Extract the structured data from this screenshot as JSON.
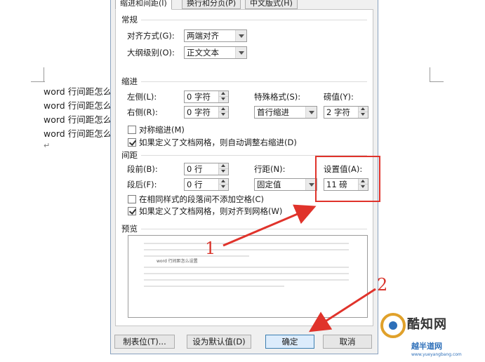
{
  "document": {
    "lines": [
      "word 行间距怎么",
      "word 行间距怎么",
      "word 行间距怎么",
      "word 行间距怎么"
    ],
    "para_mark": "↵"
  },
  "dialog": {
    "tabs": [
      {
        "label": "缩进和间距(I)",
        "active": true
      },
      {
        "label": "换行和分页(P)",
        "active": false
      },
      {
        "label": "中文版式(H)",
        "active": false
      }
    ],
    "general": {
      "title": "常规",
      "alignment_label": "对齐方式(G):",
      "alignment_value": "两端对齐",
      "outline_label": "大纲级别(O):",
      "outline_value": "正文文本"
    },
    "indent": {
      "title": "缩进",
      "left_label": "左侧(L):",
      "left_value": "0 字符",
      "right_label": "右侧(R):",
      "right_value": "0 字符",
      "special_label": "特殊格式(S):",
      "special_value": "首行缩进",
      "by_label": "磅值(Y):",
      "by_value": "2 字符",
      "mirror_label": "对称缩进(M)",
      "mirror_checked": false,
      "auto_adjust_label": "如果定义了文档网格，则自动调整右缩进(D)",
      "auto_adjust_checked": true
    },
    "spacing": {
      "title": "间距",
      "before_label": "段前(B):",
      "before_value": "0 行",
      "after_label": "段后(F):",
      "after_value": "0 行",
      "line_spacing_label": "行距(N):",
      "line_spacing_value": "固定值",
      "at_label": "设置值(A):",
      "at_value": "11 磅",
      "no_space_label": "在相同样式的段落间不添加空格(C)",
      "no_space_checked": false,
      "snap_grid_label": "如果定义了文档网格，则对齐到网格(W)",
      "snap_grid_checked": true
    },
    "preview": {
      "title": "预览",
      "sample_text": "word 行间距怎么设置"
    },
    "buttons": {
      "tabs_label": "制表位(T)...",
      "default_label": "设为默认值(D)",
      "ok_label": "确定",
      "cancel_label": "取消"
    }
  },
  "annotations": {
    "number_1": "1",
    "number_2": "2",
    "color": "#e0332b"
  },
  "watermark": {
    "title": "酷知网",
    "subtitle": "越半道网",
    "url": "www.yueyangbang.com"
  }
}
